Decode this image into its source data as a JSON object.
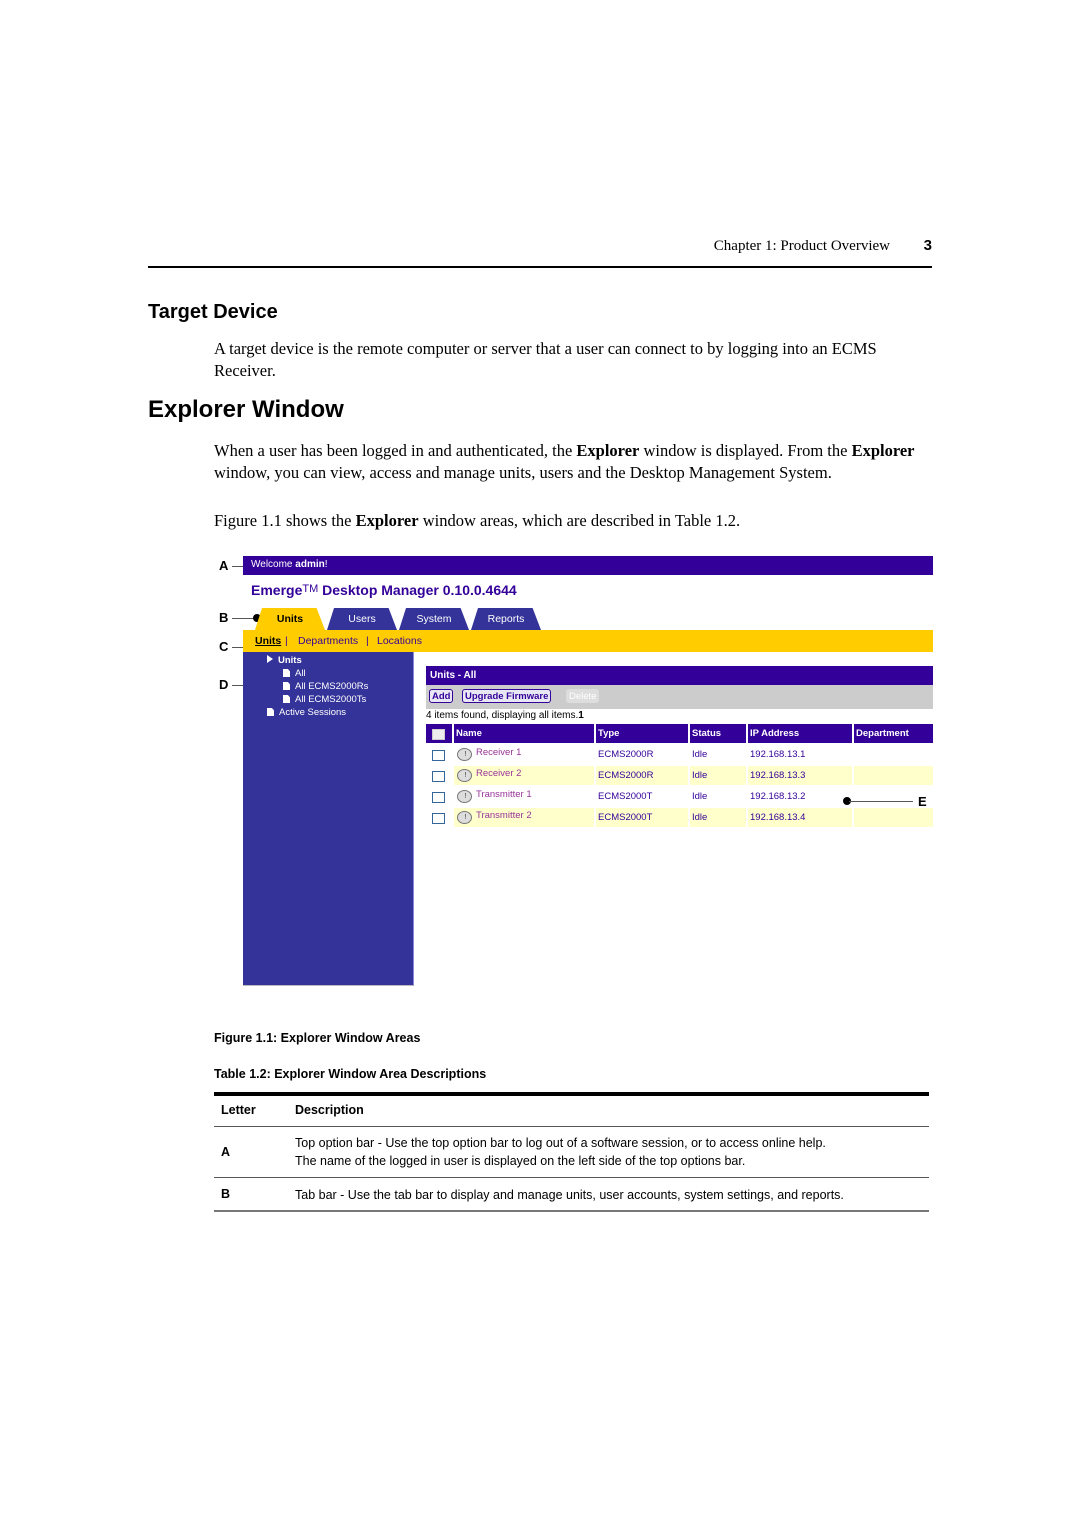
{
  "running_head": {
    "chapter": "Chapter 1: Product Overview",
    "page_number": "3"
  },
  "sections": {
    "target_device": {
      "heading": "Target Device",
      "body": "A target device is the remote computer or server that a user can connect to by logging into an ECMS Receiver."
    },
    "explorer_window": {
      "heading": "Explorer Window",
      "body_parts": [
        "When a user has been logged in and authenticated, the ",
        "Explorer",
        " window is displayed. From the ",
        "Explorer",
        " window, you can view, access and manage units, users and the Desktop Management System."
      ],
      "figref_parts": [
        "Figure 1.1 shows the ",
        "Explorer",
        " window areas, which are described in Table 1.2."
      ]
    }
  },
  "figure": {
    "callouts": [
      "A",
      "B",
      "C",
      "D",
      "E"
    ],
    "topbar": {
      "welcome": "Welcome ",
      "user": "admin",
      "suffix": "!"
    },
    "app_title": {
      "name": "Emerge",
      "tm": "TM",
      "rest": " Desktop Manager 0.10.0.4644"
    },
    "tabs": [
      {
        "label": "Units",
        "active": true
      },
      {
        "label": "Users",
        "active": false
      },
      {
        "label": "System",
        "active": false
      },
      {
        "label": "Reports",
        "active": false
      }
    ],
    "subnav": [
      {
        "label": "Units",
        "current": true
      },
      {
        "label": "|"
      },
      {
        "label": "Departments"
      },
      {
        "label": "|"
      },
      {
        "label": "Locations"
      }
    ],
    "tree": [
      {
        "label": "Units",
        "icon": "expand-triangle-icon"
      },
      {
        "label": "All",
        "icon": "page-icon"
      },
      {
        "label": "All ECMS2000Rs",
        "icon": "page-icon"
      },
      {
        "label": "All ECMS2000Ts",
        "icon": "page-icon"
      },
      {
        "label": "Active Sessions",
        "icon": "page-icon"
      }
    ],
    "panel_title": "Units - All",
    "buttons": {
      "add": "Add",
      "upgrade": "Upgrade Firmware",
      "delete": "Delete"
    },
    "count_text": "4 items found, displaying all items.",
    "page_indicator": "1",
    "columns": [
      "Name",
      "Type",
      "Status",
      "IP Address",
      "Department"
    ],
    "rows": [
      {
        "name": "Receiver 1",
        "type": "ECMS2000R",
        "status": "Idle",
        "ip": "192.168.13.1",
        "department": ""
      },
      {
        "name": "Receiver 2",
        "type": "ECMS2000R",
        "status": "Idle",
        "ip": "192.168.13.3",
        "department": ""
      },
      {
        "name": "Transmitter 1",
        "type": "ECMS2000T",
        "status": "Idle",
        "ip": "192.168.13.2",
        "department": ""
      },
      {
        "name": "Transmitter 2",
        "type": "ECMS2000T",
        "status": "Idle",
        "ip": "192.168.13.4",
        "department": ""
      }
    ],
    "colors": {
      "purple": "#330099",
      "sidebar": "#333399",
      "yellow": "#ffcc00",
      "row_alt": "#ffffcc",
      "link": "#993399"
    }
  },
  "captions": {
    "figure": "Figure 1.1:  Explorer Window Areas",
    "table": "Table 1.2:  Explorer Window Area Descriptions"
  },
  "table": {
    "headers": [
      "Letter",
      "Description"
    ],
    "rows": [
      {
        "letter": "A",
        "description_lines": [
          "Top option bar - Use the top option bar to log out of a software session, or to access online help.",
          "The name of the logged in user is displayed on the left side of the top options bar."
        ]
      },
      {
        "letter": "B",
        "description_lines": [
          "Tab bar - Use the tab bar to display and manage units, user accounts, system settings, and reports."
        ]
      }
    ]
  }
}
